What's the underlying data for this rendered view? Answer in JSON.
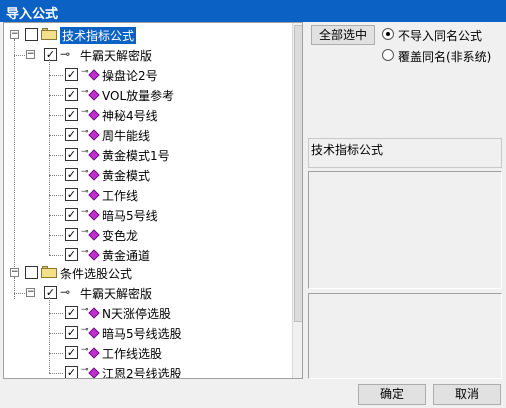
{
  "window": {
    "title": "导入公式"
  },
  "toolbar": {
    "select_all": "全部选中"
  },
  "options": [
    {
      "label": "不导入同名公式",
      "selected": true
    },
    {
      "label": "覆盖同名(非系统)",
      "selected": false
    }
  ],
  "info_panel": {
    "title": "技术指标公式"
  },
  "tree": {
    "groups": [
      {
        "label": "技术指标公式",
        "sub": "牛霸天解密版",
        "items": [
          "操盘论2号",
          "VOL放量参考",
          "神秘4号线",
          "周牛能线",
          "黄金模式1号",
          "黄金模式",
          "工作线",
          "暗马5号线",
          "变色龙",
          "黄金通道"
        ]
      },
      {
        "label": "条件选股公式",
        "sub": "牛霸天解密版",
        "items": [
          "N天涨停选股",
          "暗马5号线选股",
          "工作线选股",
          "江恩2号线选股"
        ]
      }
    ]
  },
  "buttons": {
    "ok": "确定",
    "cancel": "取消"
  },
  "colors": {
    "titlebar": "#0c62c4",
    "selection": "#0c62c4",
    "diamond": "#c12fd1"
  }
}
